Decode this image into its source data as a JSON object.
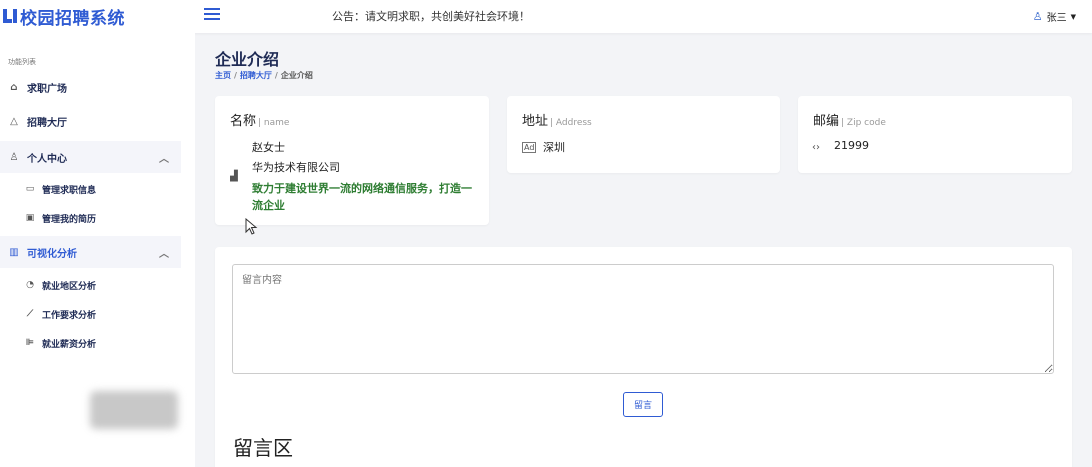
{
  "header": {
    "brand": "校园招聘系统",
    "notice": "公告：请文明求职，共创美好社会环境！",
    "user": "张三"
  },
  "sidebar": {
    "heading": "功能列表",
    "items": [
      {
        "label": "求职广场",
        "icon": "home-icon"
      },
      {
        "label": "招聘大厅",
        "icon": "shapes-icon"
      },
      {
        "label": "个人中心",
        "icon": "user-icon",
        "expanded": true
      },
      {
        "label": "管理求职信息",
        "icon": "message-icon"
      },
      {
        "label": "管理我的简历",
        "icon": "document-icon"
      },
      {
        "label": "可视化分析",
        "icon": "bar-chart-icon",
        "expanded": true
      },
      {
        "label": "就业地区分析",
        "icon": "pie-chart-icon"
      },
      {
        "label": "工作要求分析",
        "icon": "line-chart-icon"
      },
      {
        "label": "就业薪资分析",
        "icon": "bar-chart-icon"
      }
    ]
  },
  "page": {
    "title": "企业介绍",
    "breadcrumb": [
      "主页",
      "招聘大厅",
      "企业介绍"
    ]
  },
  "cards": {
    "name": {
      "title": "名称",
      "subtitle": "| name",
      "contact": "赵女士",
      "company": "华为技术有限公司",
      "slogan": "致力于建设世界一流的网络通信服务，打造一流企业"
    },
    "address": {
      "title": "地址",
      "subtitle": "| Address",
      "value": "深圳"
    },
    "zip": {
      "title": "邮编",
      "subtitle": "| Zip code",
      "value": "21999"
    }
  },
  "message": {
    "placeholder": "留言内容",
    "button": "留言",
    "section_title": "留言区"
  },
  "colors": {
    "accent": "#2f5bd3",
    "slogan": "#2e7d32",
    "background": "#f3f4f7"
  }
}
